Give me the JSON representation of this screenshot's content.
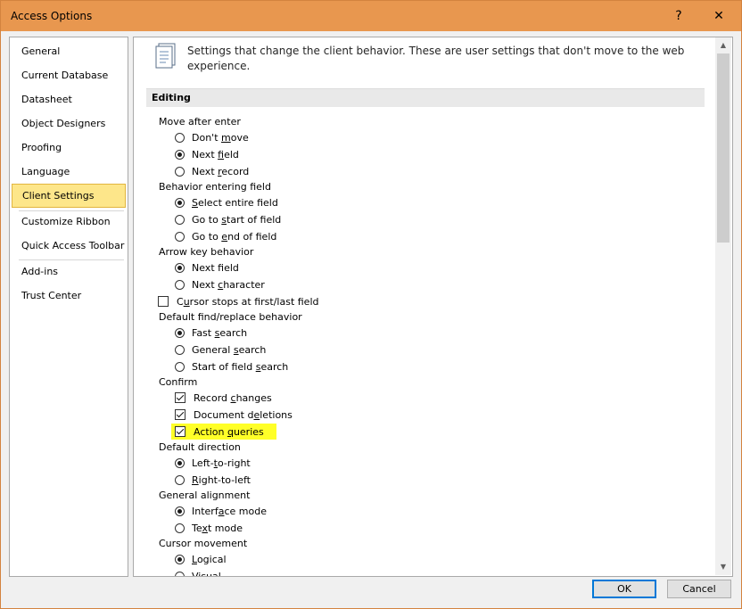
{
  "window": {
    "title": "Access Options",
    "help_glyph": "?",
    "close_glyph": "✕"
  },
  "nav": {
    "items": [
      {
        "label": "General"
      },
      {
        "label": "Current Database"
      },
      {
        "label": "Datasheet"
      },
      {
        "label": "Object Designers"
      },
      {
        "label": "Proofing"
      },
      {
        "label": "Language"
      },
      {
        "label": "Client Settings",
        "selected": true
      },
      {
        "label": "Customize Ribbon"
      },
      {
        "label": "Quick Access Toolbar"
      },
      {
        "label": "Add-ins"
      },
      {
        "label": "Trust Center"
      }
    ]
  },
  "content": {
    "intro_icon": "settings-document-icon",
    "intro": "Settings that change the client behavior. These are user settings that don't move to the web experience.",
    "section_title": "Editing",
    "groups": {
      "move_after_enter": {
        "label": "Move after enter",
        "options": [
          {
            "pre": "Don't ",
            "key": "m",
            "post": "ove",
            "checked": false
          },
          {
            "pre": "Next ",
            "key": "f",
            "post": "ield",
            "checked": true
          },
          {
            "pre": "Next ",
            "key": "r",
            "post": "ecord",
            "checked": false
          }
        ]
      },
      "behavior_entering_field": {
        "label": "Behavior entering field",
        "options": [
          {
            "pre": "",
            "key": "S",
            "post": "elect entire field",
            "checked": true
          },
          {
            "pre": "Go to ",
            "key": "s",
            "post": "tart of field",
            "checked": false
          },
          {
            "pre": "Go to ",
            "key": "e",
            "post": "nd of field",
            "checked": false
          }
        ]
      },
      "arrow_key_behavior": {
        "label": "Arrow key behavior",
        "options": [
          {
            "pre": "Next f",
            "key": "i",
            "post": "eld",
            "checked": true
          },
          {
            "pre": "Next ",
            "key": "c",
            "post": "haracter",
            "checked": false
          }
        ]
      },
      "cursor_stops": {
        "pre": "C",
        "key": "u",
        "post": "rsor stops at first/last field",
        "checked": false
      },
      "default_find_replace": {
        "label": "Default find/replace behavior",
        "options": [
          {
            "pre": "Fast ",
            "key": "s",
            "post": "earch",
            "checked": true
          },
          {
            "pre": "General ",
            "key": "s",
            "post": "earch",
            "checked": false
          },
          {
            "pre": "Start of field ",
            "key": "s",
            "post": "earch",
            "checked": false
          }
        ]
      },
      "confirm": {
        "label": "Confirm",
        "options": [
          {
            "pre": "Record ",
            "key": "c",
            "post": "hanges",
            "checked": true
          },
          {
            "pre": "Document d",
            "key": "e",
            "post": "letions",
            "checked": true
          },
          {
            "pre": "Action ",
            "key": "q",
            "post": "ueries",
            "checked": true,
            "highlight": "#ffff28"
          }
        ]
      },
      "default_direction": {
        "label": "Default direction",
        "options": [
          {
            "pre": "Left-",
            "key": "t",
            "post": "o-right",
            "checked": true
          },
          {
            "pre": "",
            "key": "R",
            "post": "ight-to-left",
            "checked": false
          }
        ]
      },
      "general_alignment": {
        "label": "General alignment",
        "options": [
          {
            "pre": "Interf",
            "key": "a",
            "post": "ce mode",
            "checked": true
          },
          {
            "pre": "Te",
            "key": "x",
            "post": "t mode",
            "checked": false
          }
        ]
      },
      "cursor_movement": {
        "label": "Cursor movement",
        "options": [
          {
            "pre": "",
            "key": "L",
            "post": "ogical",
            "checked": true
          },
          {
            "pre": "",
            "key": "V",
            "post": "isual",
            "checked": false
          }
        ]
      }
    }
  },
  "scrollbar": {
    "up_glyph": "▲",
    "down_glyph": "▼"
  },
  "buttons": {
    "ok": "OK",
    "cancel": "Cancel"
  },
  "colors": {
    "titlebar": "#e8974f",
    "selected_nav": "#fde68a",
    "highlight": "#ffff28",
    "default_button_border": "#0078d7"
  }
}
